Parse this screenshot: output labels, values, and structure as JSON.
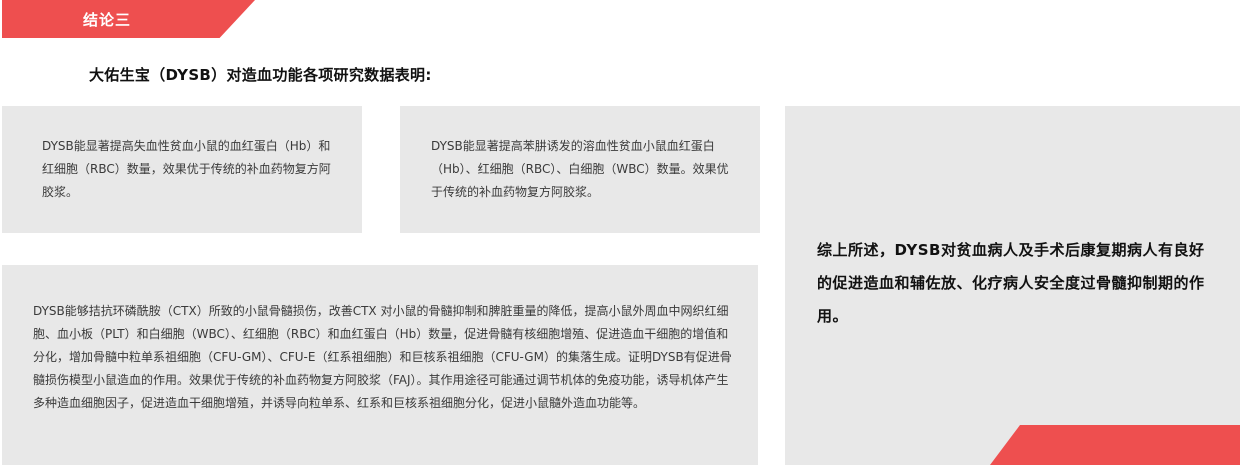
{
  "banner": {
    "label": "结论三"
  },
  "heading": "大佑生宝（DYSB）对造血功能各项研究数据表明:",
  "cards": [
    {
      "text": "DYSB能显著提高失血性贫血小鼠的血红蛋白（Hb）和红细胞（RBC）数量，效果优于传统的补血药物复方阿胶浆。"
    },
    {
      "text": "DYSB能显著提高苯肼诱发的溶血性贫血小鼠血红蛋白（Hb）、红细胞（RBC）、白细胞（WBC）数量。效果优于传统的补血药物复方阿胶浆。"
    },
    {
      "text": "DYSB能够拮抗环磷酰胺（CTX）所致的小鼠骨髓损伤，改善CTX 对小鼠的骨髓抑制和脾脏重量的降低，提高小鼠外周血中网织红细胞、血小板（PLT）和白细胞（WBC）、红细胞（RBC）和血红蛋白（Hb）数量，促进骨髓有核细胞增殖、促进造血干细胞的增值和分化，增加骨髓中粒单系祖细胞（CFU-GM）、CFU-E（红系祖细胞）和巨核系祖细胞（CFU-GM）的集落生成。证明DYSB有促进骨髓损伤模型小鼠造血的作用。效果优于传统的补血药物复方阿胶浆（FAJ）。其作用途径可能通过调节机体的免疫功能，诱导机体产生多种造血细胞因子，促进造血干细胞增殖，并诱导向粒单系、红系和巨核系祖细胞分化，促进小鼠髓外造血功能等。"
    }
  ],
  "summary": "综上所述，DYSB对贫血病人及手术后康复期病人有良好的促进造血和辅佐放、化疗病人安全度过骨髓抑制期的作用。",
  "colors": {
    "accent": "#ee4f4f",
    "card_bg": "#e8e8e8"
  }
}
